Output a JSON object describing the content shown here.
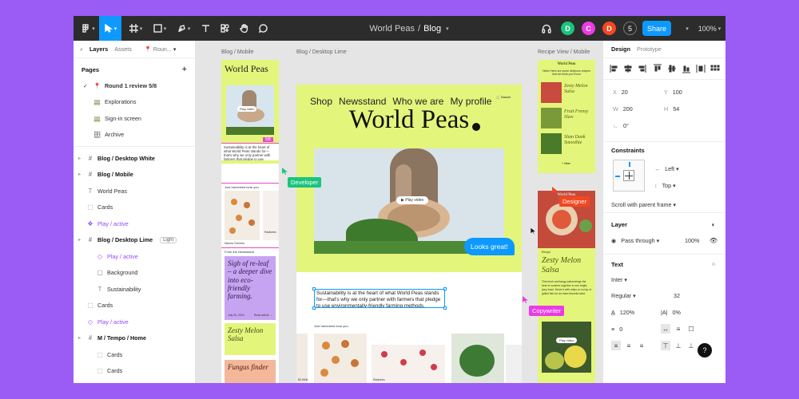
{
  "window": {
    "breadcrumb_project": "World Peas",
    "breadcrumb_sep": "/",
    "breadcrumb_file": "Blog",
    "collaborators": [
      {
        "initial": "D",
        "color": "#1bc47d"
      },
      {
        "initial": "C",
        "color": "#e93ce4"
      },
      {
        "initial": "D",
        "color": "#f24822"
      }
    ],
    "collab_count": "5",
    "share_label": "Share",
    "zoom": "100%"
  },
  "left_panel": {
    "tabs": [
      "Layers",
      "Assets"
    ],
    "page_selector": "Roun...",
    "pages_heading": "Pages",
    "pages": [
      {
        "label": "Round 1 review 5/8",
        "emoji": "📍",
        "current": true
      },
      {
        "label": "Explorations",
        "emoji": "🚃"
      },
      {
        "label": "Sign-in screen",
        "emoji": "🚃"
      },
      {
        "label": "Archive",
        "emoji": "🗄"
      }
    ],
    "layers": [
      {
        "label": "Blog / Desktop White",
        "type": "frame",
        "indent": 0,
        "bold": true
      },
      {
        "label": "Blog / Mobile",
        "type": "frame",
        "indent": 0,
        "bold": true
      },
      {
        "label": "World Peas",
        "type": "text",
        "indent": 0
      },
      {
        "label": "Cards",
        "type": "group",
        "indent": 0
      },
      {
        "label": "Play / active",
        "type": "component",
        "indent": 0,
        "purple": true
      },
      {
        "label": "Blog / Desktop Lime",
        "type": "frame",
        "indent": 0,
        "bold": true,
        "tag": "Light"
      },
      {
        "label": "Play / active",
        "type": "instance",
        "indent": 1,
        "purple": true
      },
      {
        "label": "Background",
        "type": "rect",
        "indent": 1
      },
      {
        "label": "Sustainability",
        "type": "text",
        "indent": 1
      },
      {
        "label": "Cards",
        "type": "group",
        "indent": 0
      },
      {
        "label": "Play / active",
        "type": "instance",
        "indent": 0,
        "purple": true
      },
      {
        "label": "M / Tempo / Home",
        "type": "frame",
        "indent": 0,
        "bold": true
      },
      {
        "label": "Cards",
        "type": "group",
        "indent": 1
      },
      {
        "label": "Cards",
        "type": "group",
        "indent": 1
      }
    ]
  },
  "canvas": {
    "frame_labels": {
      "mobile": "Blog / Mobile",
      "desktop": "Blog / Desktop Lime",
      "recipe": "Recipe View / Mobile"
    },
    "mobile": {
      "logo": "World Peas",
      "play": "Play video",
      "size_badge": "56",
      "body": "Sustainability is at the heart of what World Peas stands for—that's why we only partner with farmers that pledge to use environmentally-friendly farming methods.",
      "caption": "Just harvested near you",
      "item1": "Manna Cherries",
      "item2": "Radishes",
      "section": "From the Newsstand",
      "card1_title": "Sigh of re-leaf – a deeper dive into eco-friendly farming.",
      "card1_date": "July 20, 2024",
      "card1_link": "Read article →",
      "card2_title": "Zesty Melon Salsa",
      "card3_title": "Fungus finder"
    },
    "desktop": {
      "nav": [
        "Shop",
        "Newsstand",
        "Who we are",
        "My profile"
      ],
      "basket": "Basket",
      "title": "World Peas",
      "play": "Play video",
      "sustain": "Sustainability is at the heart of what World Peas stands for—that's why we only partner with farmers that pledge to use environmentally-friendly farming methods.",
      "caption": "Just harvested near you",
      "item1": "$3.99/lb",
      "item2": "Radishes",
      "chat": "Looks great!"
    },
    "recipe": {
      "logo": "World Peas",
      "intro": "Hello! Here are some delicious recipes that we think you'll love",
      "recipes": [
        "Zesty Melon Salsa",
        "Fruit Frenzy Slaw",
        "Slam Dunk Smoothie"
      ],
      "view_more": "+ View",
      "hero_logo": "World Peas",
      "kicker": "Recipe",
      "hero_title": "Zesty Melon Salsa",
      "body": "This fresh and tangy salsa brings the best of summer together in one bright, juicy bowl. Serve it with chips or on top of grilled fish for an extra flavorful twist.",
      "play": "Play video"
    },
    "cursors": {
      "developer": "Developer",
      "designer": "Designer",
      "copywriter": "Copywriter"
    }
  },
  "right_panel": {
    "tabs": [
      "Design",
      "Prototype"
    ],
    "x_label": "X",
    "x": "20",
    "y_label": "Y",
    "y": "100",
    "w_label": "W",
    "w": "200",
    "h_label": "H",
    "h": "54",
    "rotation": "0°",
    "constraints_heading": "Constraints",
    "horizontal": "Left",
    "vertical": "Top",
    "scroll": "Scroll with parent frame",
    "layer_heading": "Layer",
    "blend": "Pass through",
    "opacity": "100%",
    "text_heading": "Text",
    "font": "Inter",
    "weight": "Regular",
    "size": "32",
    "line_height": "120%",
    "letter_spacing": "0%",
    "paragraph": "0",
    "help": "?"
  }
}
